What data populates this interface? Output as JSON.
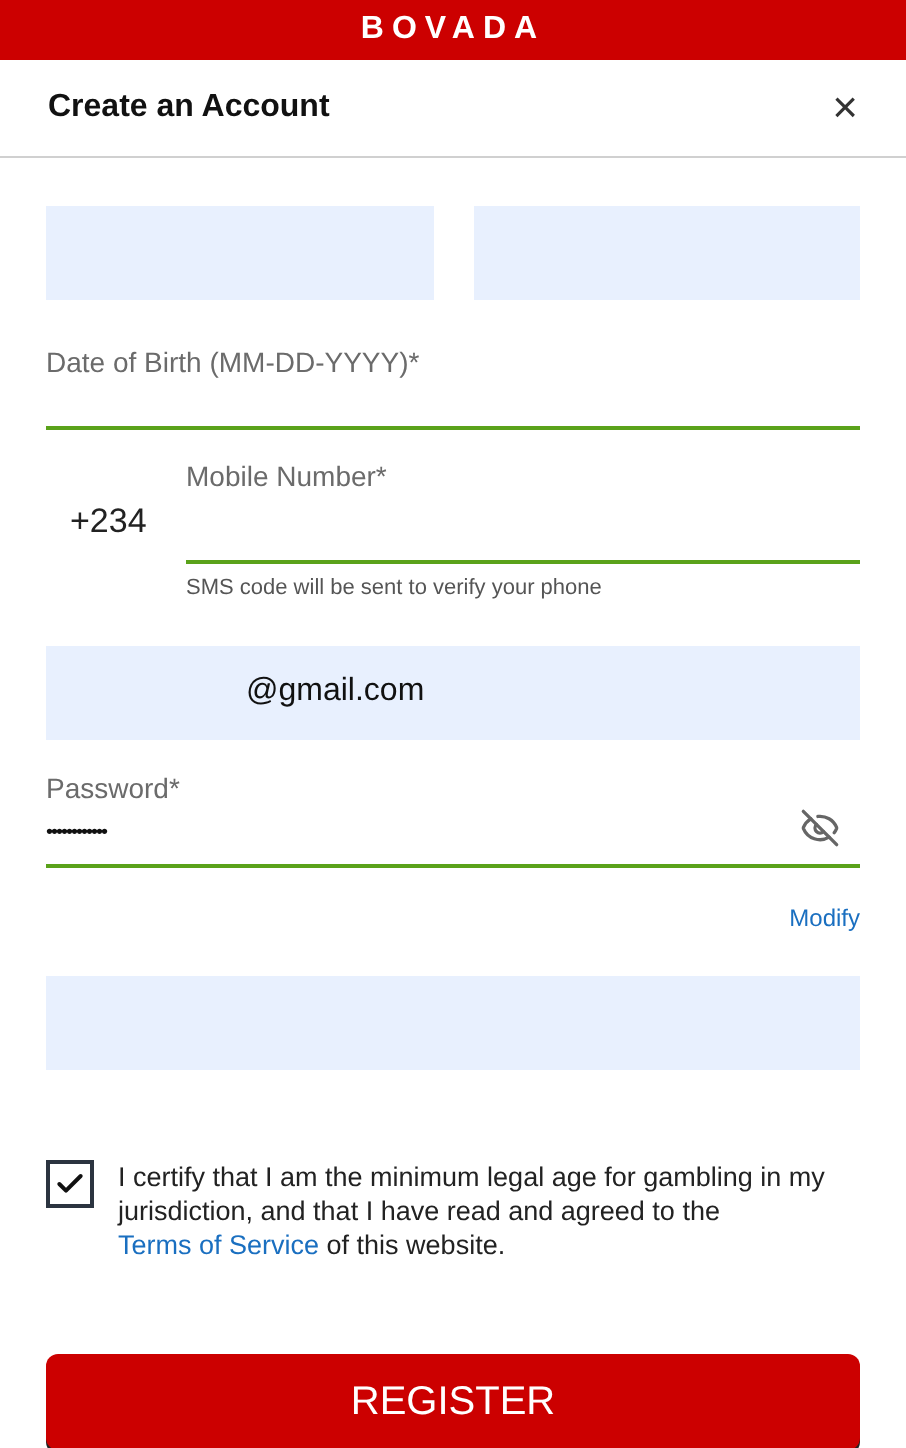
{
  "brand": "BOVADA",
  "dialog": {
    "title": "Create an Account",
    "close": "×"
  },
  "fields": [
    {
      "kind": "pair"
    },
    {
      "kind": "underline",
      "label": "Date of Birth (MM-DD-YYYY)*"
    },
    {
      "kind": "phone",
      "prefix": "+234",
      "label": "Mobile Number*",
      "hint": "SMS code will be sent to verify your phone"
    },
    {
      "kind": "box",
      "value": "@gmail.com"
    },
    {
      "kind": "password",
      "label": "Password*",
      "value": "••••••••••••"
    },
    {
      "kind": "link",
      "label": "Modify"
    },
    {
      "kind": "box"
    }
  ],
  "agreement": {
    "checked": true,
    "text_before": "I certify that I am the minimum legal age for gambling in my jurisdiction, and that I have read and agreed to the ",
    "link": "Terms of Service",
    "text_after": " of this website."
  },
  "submit": "REGISTER"
}
